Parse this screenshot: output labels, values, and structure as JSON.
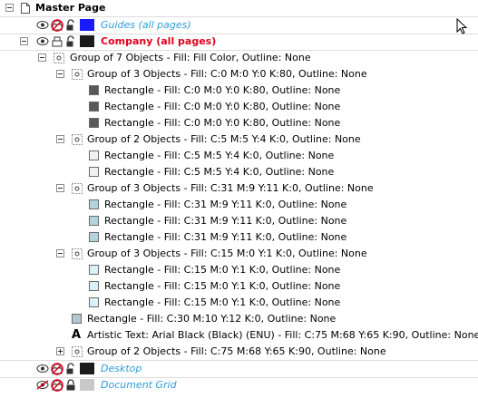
{
  "master": {
    "label": "Master Page",
    "icon": "page-icon"
  },
  "layers": {
    "guides": {
      "label": "Guides (all pages)",
      "color": "#1a1aff"
    },
    "company": {
      "label": "Company (all pages)",
      "color": "#1b1b1b"
    },
    "desktop": {
      "label": "Desktop",
      "color": "#1b1b1b"
    },
    "document_grid": {
      "label": "Document Grid",
      "color": "#c8c8c8"
    }
  },
  "tree": {
    "group7": "Group of 7 Objects - Fill: Fill Color, Outline: None",
    "g1": {
      "label": "Group of 3 Objects - Fill: C:0 M:0 Y:0 K:80, Outline: None",
      "color": "#595959",
      "items": [
        "Rectangle - Fill: C:0 M:0 Y:0 K:80, Outline: None",
        "Rectangle - Fill: C:0 M:0 Y:0 K:80, Outline: None",
        "Rectangle - Fill: C:0 M:0 Y:0 K:80, Outline: None"
      ]
    },
    "g2": {
      "label": "Group of 2 Objects - Fill: C:5 M:5 Y:4 K:0, Outline: None",
      "color": "#f2f1f3",
      "items": [
        "Rectangle - Fill: C:5 M:5 Y:4 K:0, Outline: None",
        "Rectangle - Fill: C:5 M:5 Y:4 K:0, Outline: None"
      ]
    },
    "g3": {
      "label": "Group of 3 Objects - Fill: C:31 M:9 Y:11 K:0, Outline: None",
      "color": "#b0d3dc",
      "items": [
        "Rectangle - Fill: C:31 M:9 Y:11 K:0, Outline: None",
        "Rectangle - Fill: C:31 M:9 Y:11 K:0, Outline: None",
        "Rectangle - Fill: C:31 M:9 Y:11 K:0, Outline: None"
      ]
    },
    "g4": {
      "label": "Group of 3 Objects - Fill: C:15 M:0 Y:1 K:0, Outline: None",
      "color": "#dcf0fa",
      "items": [
        "Rectangle - Fill: C:15 M:0 Y:1 K:0, Outline: None",
        "Rectangle - Fill: C:15 M:0 Y:1 K:0, Outline: None",
        "Rectangle - Fill: C:15 M:0 Y:1 K:0, Outline: None"
      ]
    },
    "rect": {
      "label": "Rectangle - Fill: C:30 M:10 Y:12 K:0, Outline: None",
      "color": "#b0c7cf"
    },
    "text": {
      "label": "Artistic Text: Arial Black (Black) (ENU) - Fill: C:75 M:68 Y:65 K:90, Outline: None",
      "icon_glyph": "A"
    },
    "g5": {
      "label": "Group of 2 Objects - Fill: C:75 M:68 Y:65 K:90, Outline: None"
    }
  }
}
